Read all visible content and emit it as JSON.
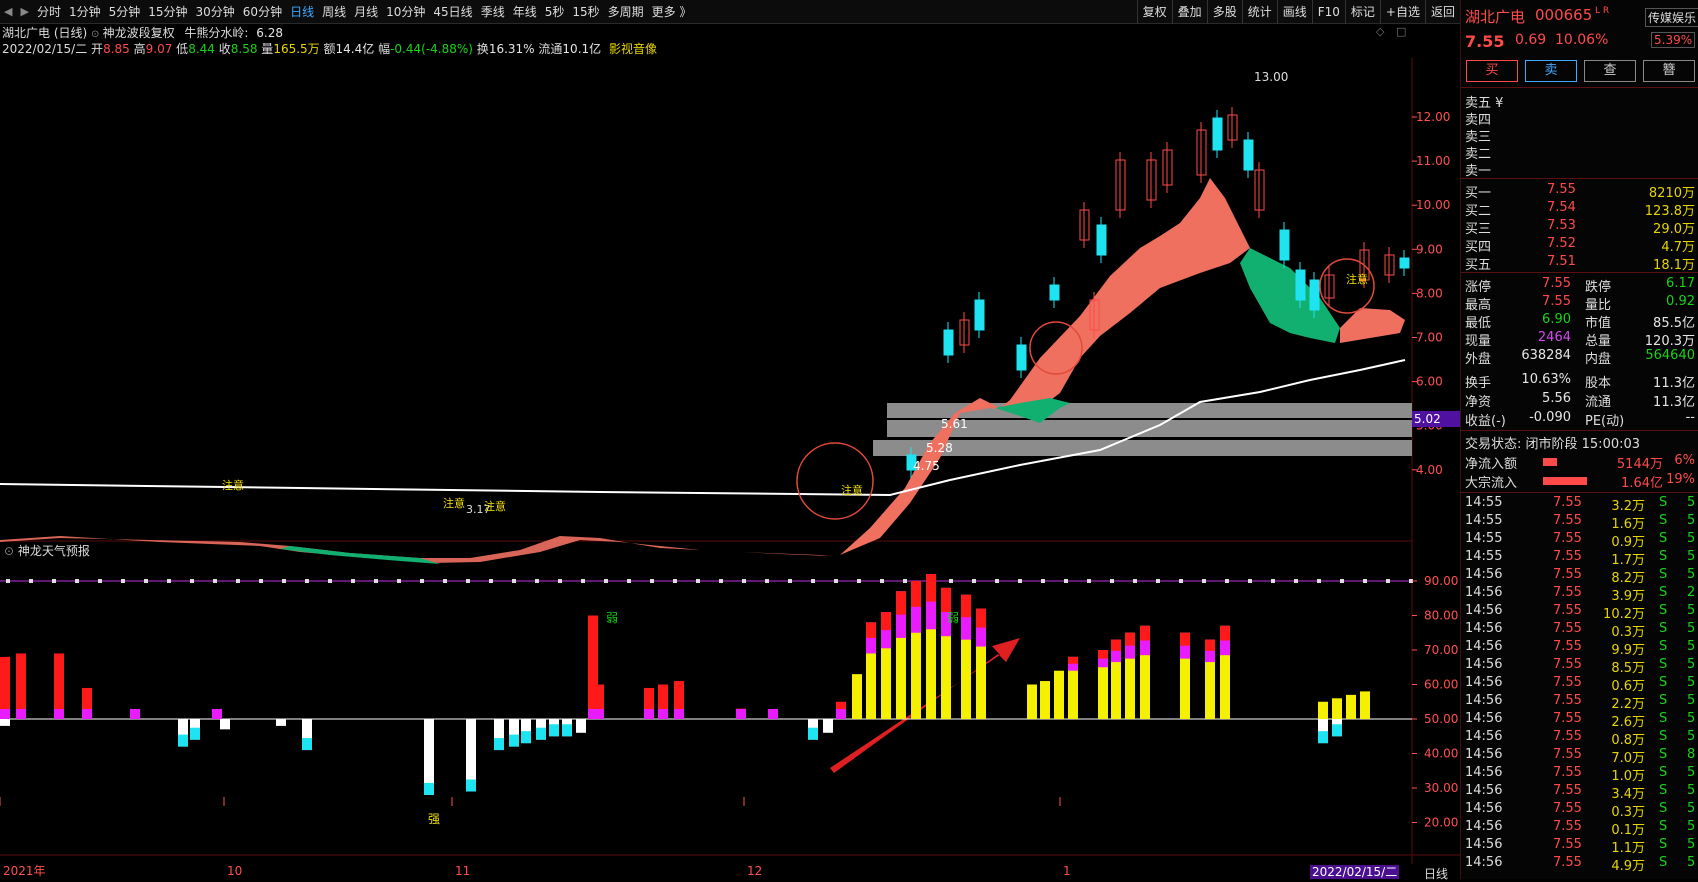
{
  "toolbar": {
    "left_items": [
      "分时",
      "1分钟",
      "5分钟",
      "15分钟",
      "30分钟",
      "60分钟",
      "日线",
      "周线",
      "月线",
      "10分钟",
      "45日线",
      "季线",
      "年线",
      "5秒",
      "15秒",
      "多周期",
      "更多 》"
    ],
    "active": "日线",
    "right_items": [
      "复权",
      "叠加",
      "多股",
      "统计",
      "画线",
      "F10",
      "标记",
      "+自选",
      "返回"
    ]
  },
  "header": {
    "stock": "湖北广电 (日线)",
    "indicator": "神龙波段复权",
    "watershed_label": "牛熊分水岭:",
    "watershed": "6.28"
  },
  "price_row": {
    "date": "2022/02/15/二",
    "open_label": "开",
    "open": "8.85",
    "high_label": "高",
    "high": "9.07",
    "low_label": "低",
    "low": "8.44",
    "close_label": "收",
    "close": "8.58",
    "vol_label": "量",
    "vol": "165.5万",
    "amt_label": "额",
    "amt": "14.4亿",
    "chg_label": "幅",
    "chg": "-0.44(-4.88%)",
    "turn_label": "换",
    "turn": "16.31%",
    "float_label": "流通",
    "float": "10.1亿",
    "sector": "影视音像"
  },
  "main_chart": {
    "price_ticks": [
      "12.00",
      "11.00",
      "10.00",
      "9.00",
      "8.00",
      "7.00",
      "6.00",
      "5.00",
      "4.00"
    ],
    "current_price_tag": "5.02",
    "high_marker": "13.00",
    "zone_labels": [
      "5.61",
      "5.28",
      "4.75"
    ],
    "low_marker": "3.17",
    "signal_label": "注意"
  },
  "sub_chart": {
    "title": "神龙天气预报",
    "ticks": [
      "90.00",
      "80.00",
      "70.00",
      "60.00",
      "50.00",
      "40.00",
      "30.00",
      "20.00"
    ],
    "strong_label": "强",
    "weak_label": "弱"
  },
  "date_axis": {
    "labels": [
      "2021年",
      "10",
      "11",
      "12",
      "1"
    ],
    "current": "2022/02/15/二",
    "period": "日线"
  },
  "quote": {
    "name": "湖北广电",
    "code": "000665",
    "flags": "L R",
    "sector_tag": "传媒娱乐",
    "sector_pct": "5.39%",
    "price": "7.55",
    "change": "0.69",
    "pct": "10.06%",
    "buttons": [
      "买",
      "卖",
      "查",
      "簪"
    ],
    "sells": [
      "卖五 ¥",
      "卖四",
      "卖三",
      "卖二",
      "卖一"
    ],
    "buys": [
      {
        "label": "买一",
        "price": "7.55",
        "vol": "8210万"
      },
      {
        "label": "买二",
        "price": "7.54",
        "vol": "123.8万"
      },
      {
        "label": "买三",
        "price": "7.53",
        "vol": "29.0万"
      },
      {
        "label": "买四",
        "price": "7.52",
        "vol": "4.7万"
      },
      {
        "label": "买五",
        "price": "7.51",
        "vol": "18.1万"
      }
    ],
    "stats": [
      [
        "涨停",
        "7.55",
        "跌停",
        "6.17"
      ],
      [
        "最高",
        "7.55",
        "量比",
        "0.92"
      ],
      [
        "最低",
        "6.90",
        "市值",
        "85.5亿"
      ],
      [
        "现量",
        "2464",
        "总量",
        "120.3万"
      ],
      [
        "外盘",
        "638284",
        "内盘",
        "564640"
      ],
      [
        "换手",
        "10.63%",
        "股本",
        "11.3亿"
      ],
      [
        "净资",
        "5.56",
        "流通",
        "11.3亿"
      ],
      [
        "收益(-)",
        "-0.090",
        "PE(动)",
        "--"
      ]
    ],
    "status": "交易状态: 闭市阶段 15:00:03",
    "flows": [
      {
        "label": "净流入额",
        "value": "5144万",
        "pct": "6%"
      },
      {
        "label": "大宗流入",
        "value": "1.64亿",
        "pct": "19%"
      }
    ],
    "ticks": [
      [
        "14:55",
        "7.55",
        "3.2万",
        "S",
        "5"
      ],
      [
        "14:55",
        "7.55",
        "1.6万",
        "S",
        "5"
      ],
      [
        "14:55",
        "7.55",
        "0.9万",
        "S",
        "5"
      ],
      [
        "14:55",
        "7.55",
        "1.7万",
        "S",
        "5"
      ],
      [
        "14:56",
        "7.55",
        "8.2万",
        "S",
        "5"
      ],
      [
        "14:56",
        "7.55",
        "3.9万",
        "S",
        "2"
      ],
      [
        "14:56",
        "7.55",
        "10.2万",
        "S",
        "5"
      ],
      [
        "14:56",
        "7.55",
        "0.3万",
        "S",
        "5"
      ],
      [
        "14:56",
        "7.55",
        "9.9万",
        "S",
        "5"
      ],
      [
        "14:56",
        "7.55",
        "8.5万",
        "S",
        "5"
      ],
      [
        "14:56",
        "7.55",
        "0.6万",
        "S",
        "5"
      ],
      [
        "14:56",
        "7.55",
        "2.2万",
        "S",
        "5"
      ],
      [
        "14:56",
        "7.55",
        "2.6万",
        "S",
        "5"
      ],
      [
        "14:56",
        "7.55",
        "0.8万",
        "S",
        "5"
      ],
      [
        "14:56",
        "7.55",
        "7.0万",
        "S",
        "8"
      ],
      [
        "14:56",
        "7.55",
        "1.0万",
        "S",
        "5"
      ],
      [
        "14:56",
        "7.55",
        "3.4万",
        "S",
        "5"
      ],
      [
        "14:56",
        "7.55",
        "0.3万",
        "S",
        "5"
      ],
      [
        "14:56",
        "7.55",
        "0.1万",
        "S",
        "5"
      ],
      [
        "14:56",
        "7.55",
        "1.1万",
        "S",
        "5"
      ],
      [
        "14:56",
        "7.55",
        "4.9万",
        "S",
        "5"
      ]
    ]
  },
  "colors": {
    "up": "#ff4a4a",
    "down": "#1ee3f0",
    "band_up": "#f07060",
    "band_down": "#12b070",
    "yellow": "#f5f000",
    "magenta": "#e81cff",
    "accent": "#3fa9ff"
  }
}
